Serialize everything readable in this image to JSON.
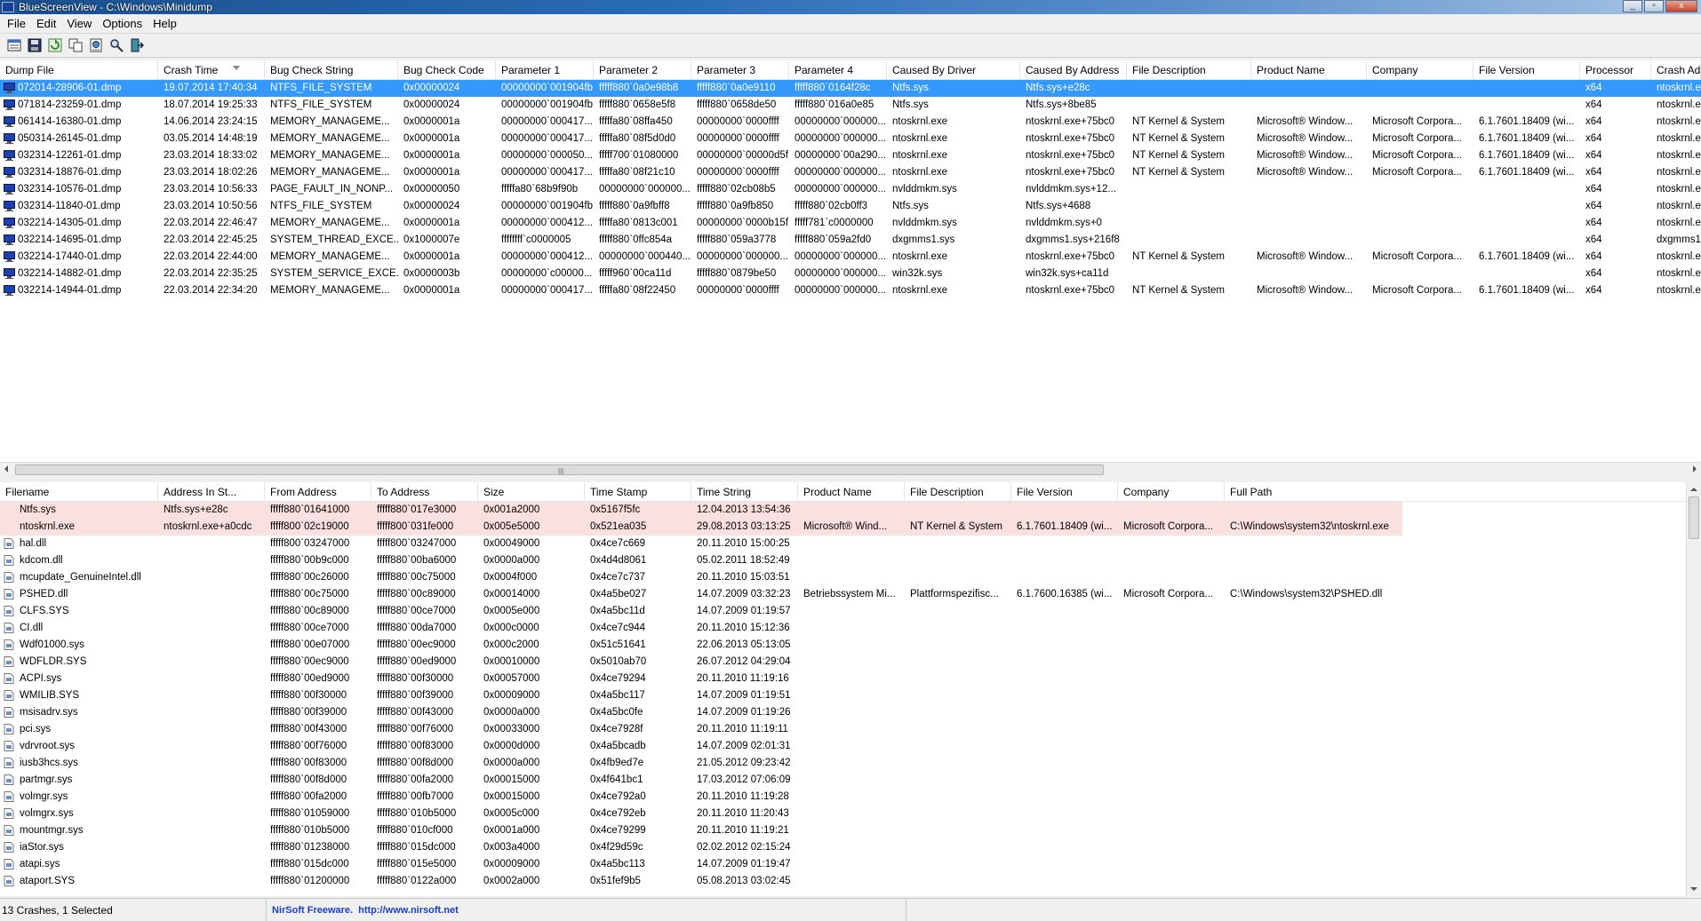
{
  "window": {
    "title": "BlueScreenView  -  C:\\Windows\\Minidump"
  },
  "menu": [
    "File",
    "Edit",
    "View",
    "Options",
    "Help"
  ],
  "toolbar": {
    "buttons": [
      "properties-icon",
      "save-icon",
      "refresh-icon",
      "copy-icon",
      "html-report-icon",
      "find-icon",
      "exit-icon"
    ]
  },
  "top_table": {
    "columns": [
      "Dump File",
      "Crash Time",
      "Bug Check String",
      "Bug Check Code",
      "Parameter 1",
      "Parameter 2",
      "Parameter 3",
      "Parameter 4",
      "Caused By Driver",
      "Caused By Address",
      "File Description",
      "Product Name",
      "Company",
      "File Version",
      "Processor",
      "Crash Ad"
    ],
    "sorted_column": "Crash Time",
    "rows": [
      [
        "072014-28906-01.dmp",
        "19.07.2014 17:40:34",
        "NTFS_FILE_SYSTEM",
        "0x00000024",
        "00000000`001904fb",
        "fffff880`0a0e98b8",
        "fffff880`0a0e9110",
        "fffff880`0164f28c",
        "Ntfs.sys",
        "Ntfs.sys+e28c",
        "",
        "",
        "",
        "",
        "x64",
        "ntoskrnl.e"
      ],
      [
        "071814-23259-01.dmp",
        "18.07.2014 19:25:33",
        "NTFS_FILE_SYSTEM",
        "0x00000024",
        "00000000`001904fb",
        "fffff880`0658e5f8",
        "fffff880`0658de50",
        "fffff880`016a0e85",
        "Ntfs.sys",
        "Ntfs.sys+8be85",
        "",
        "",
        "",
        "",
        "x64",
        "ntoskrnl.e"
      ],
      [
        "061414-16380-01.dmp",
        "14.06.2014 23:24:15",
        "MEMORY_MANAGEME...",
        "0x0000001a",
        "00000000`000417...",
        "fffffa80`08ffa450",
        "00000000`0000ffff",
        "00000000`000000...",
        "ntoskrnl.exe",
        "ntoskrnl.exe+75bc0",
        "NT Kernel & System",
        "Microsoft® Window...",
        "Microsoft Corpora...",
        "6.1.7601.18409 (wi...",
        "x64",
        "ntoskrnl.e"
      ],
      [
        "050314-26145-01.dmp",
        "03.05.2014 14:48:19",
        "MEMORY_MANAGEME...",
        "0x0000001a",
        "00000000`000417...",
        "fffffa80`08f5d0d0",
        "00000000`0000ffff",
        "00000000`000000...",
        "ntoskrnl.exe",
        "ntoskrnl.exe+75bc0",
        "NT Kernel & System",
        "Microsoft® Window...",
        "Microsoft Corpora...",
        "6.1.7601.18409 (wi...",
        "x64",
        "ntoskrnl.e"
      ],
      [
        "032314-12261-01.dmp",
        "23.03.2014 18:33:02",
        "MEMORY_MANAGEME...",
        "0x0000001a",
        "00000000`000050...",
        "fffff700`01080000",
        "00000000`00000d5f",
        "00000000`00a290...",
        "ntoskrnl.exe",
        "ntoskrnl.exe+75bc0",
        "NT Kernel & System",
        "Microsoft® Window...",
        "Microsoft Corpora...",
        "6.1.7601.18409 (wi...",
        "x64",
        "ntoskrnl.e"
      ],
      [
        "032314-18876-01.dmp",
        "23.03.2014 18:02:26",
        "MEMORY_MANAGEME...",
        "0x0000001a",
        "00000000`000417...",
        "fffffa80`08f21c10",
        "00000000`0000ffff",
        "00000000`000000...",
        "ntoskrnl.exe",
        "ntoskrnl.exe+75bc0",
        "NT Kernel & System",
        "Microsoft® Window...",
        "Microsoft Corpora...",
        "6.1.7601.18409 (wi...",
        "x64",
        "ntoskrnl.e"
      ],
      [
        "032314-10576-01.dmp",
        "23.03.2014 10:56:33",
        "PAGE_FAULT_IN_NONP...",
        "0x00000050",
        "fffffa80`68b9f90b",
        "00000000`000000...",
        "fffff880`02cb08b5",
        "00000000`000000...",
        "nvlddmkm.sys",
        "nvlddmkm.sys+12...",
        "",
        "",
        "",
        "",
        "x64",
        "ntoskrnl.e"
      ],
      [
        "032314-11840-01.dmp",
        "23.03.2014 10:50:56",
        "NTFS_FILE_SYSTEM",
        "0x00000024",
        "00000000`001904fb",
        "fffff880`0a9fbff8",
        "fffff880`0a9fb850",
        "fffff880`02cb0ff3",
        "Ntfs.sys",
        "Ntfs.sys+4688",
        "",
        "",
        "",
        "",
        "x64",
        "ntoskrnl.e"
      ],
      [
        "032214-14305-01.dmp",
        "22.03.2014 22:46:47",
        "MEMORY_MANAGEME...",
        "0x0000001a",
        "00000000`000412...",
        "fffffa80`0813c001",
        "00000000`0000b15f",
        "fffff781`c0000000",
        "nvlddmkm.sys",
        "nvlddmkm.sys+0",
        "",
        "",
        "",
        "",
        "x64",
        "ntoskrnl.e"
      ],
      [
        "032214-14695-01.dmp",
        "22.03.2014 22:45:25",
        "SYSTEM_THREAD_EXCE...",
        "0x1000007e",
        "ffffffff`c0000005",
        "fffff880`0ffc854a",
        "fffff880`059a3778",
        "fffff880`059a2fd0",
        "dxgmms1.sys",
        "dxgmms1.sys+216f8",
        "",
        "",
        "",
        "",
        "x64",
        "dxgmms1"
      ],
      [
        "032214-17440-01.dmp",
        "22.03.2014 22:44:00",
        "MEMORY_MANAGEME...",
        "0x0000001a",
        "00000000`000412...",
        "00000000`000440...",
        "00000000`000000...",
        "00000000`000000...",
        "ntoskrnl.exe",
        "ntoskrnl.exe+75bc0",
        "NT Kernel & System",
        "Microsoft® Window...",
        "Microsoft Corpora...",
        "6.1.7601.18409 (wi...",
        "x64",
        "ntoskrnl.e"
      ],
      [
        "032214-14882-01.dmp",
        "22.03.2014 22:35:25",
        "SYSTEM_SERVICE_EXCE...",
        "0x0000003b",
        "00000000`c00000...",
        "fffff960`00ca11d",
        "fffff880`0879be50",
        "00000000`000000...",
        "win32k.sys",
        "win32k.sys+ca11d",
        "",
        "",
        "",
        "",
        "x64",
        "ntoskrnl.e"
      ],
      [
        "032214-14944-01.dmp",
        "22.03.2014 22:34:20",
        "MEMORY_MANAGEME...",
        "0x0000001a",
        "00000000`000417...",
        "fffffa80`08f22450",
        "00000000`0000ffff",
        "00000000`000000...",
        "ntoskrnl.exe",
        "ntoskrnl.exe+75bc0",
        "NT Kernel & System",
        "Microsoft® Window...",
        "Microsoft Corpora...",
        "6.1.7601.18409 (wi...",
        "x64",
        "ntoskrnl.e"
      ]
    ]
  },
  "bottom_table": {
    "columns": [
      "Filename",
      "Address In St...",
      "From Address",
      "To Address",
      "Size",
      "Time Stamp",
      "Time String",
      "Product Name",
      "File Description",
      "File Version",
      "Company",
      "Full Path"
    ],
    "rows": [
      [
        "Ntfs.sys",
        "Ntfs.sys+e28c",
        "fffff880`01641000",
        "fffff880`017e3000",
        "0x001a2000",
        "0x5167f5fc",
        "12.04.2013 13:54:36",
        "",
        "",
        "",
        "",
        ""
      ],
      [
        "ntoskrnl.exe",
        "ntoskrnl.exe+a0cdc",
        "fffff800`02c19000",
        "fffff800`031fe000",
        "0x005e5000",
        "0x521ea035",
        "29.08.2013 03:13:25",
        "Microsoft® Wind...",
        "NT Kernel & System",
        "6.1.7601.18409 (wi...",
        "Microsoft Corpora...",
        "C:\\Windows\\system32\\ntoskrnl.exe"
      ],
      [
        "hal.dll",
        "",
        "fffff800`03247000",
        "fffff800`03247000",
        "0x00049000",
        "0x4ce7c669",
        "20.11.2010 15:00:25",
        "",
        "",
        "",
        "",
        ""
      ],
      [
        "kdcom.dll",
        "",
        "fffff880`00b9c000",
        "fffff880`00ba6000",
        "0x0000a000",
        "0x4d4d8061",
        "05.02.2011 18:52:49",
        "",
        "",
        "",
        "",
        ""
      ],
      [
        "mcupdate_GenuineIntel.dll",
        "",
        "fffff880`00c26000",
        "fffff880`00c75000",
        "0x0004f000",
        "0x4ce7c737",
        "20.11.2010 15:03:51",
        "",
        "",
        "",
        "",
        ""
      ],
      [
        "PSHED.dll",
        "",
        "fffff880`00c75000",
        "fffff880`00c89000",
        "0x00014000",
        "0x4a5be027",
        "14.07.2009 03:32:23",
        "Betriebssystem Mi...",
        "Plattformspezifisc...",
        "6.1.7600.16385 (wi...",
        "Microsoft Corpora...",
        "C:\\Windows\\system32\\PSHED.dll"
      ],
      [
        "CLFS.SYS",
        "",
        "fffff880`00c89000",
        "fffff880`00ce7000",
        "0x0005e000",
        "0x4a5bc11d",
        "14.07.2009 01:19:57",
        "",
        "",
        "",
        "",
        ""
      ],
      [
        "CI.dll",
        "",
        "fffff880`00ce7000",
        "fffff880`00da7000",
        "0x000c0000",
        "0x4ce7c944",
        "20.11.2010 15:12:36",
        "",
        "",
        "",
        "",
        ""
      ],
      [
        "Wdf01000.sys",
        "",
        "fffff880`00e07000",
        "fffff880`00ec9000",
        "0x000c2000",
        "0x51c51641",
        "22.06.2013 05:13:05",
        "",
        "",
        "",
        "",
        ""
      ],
      [
        "WDFLDR.SYS",
        "",
        "fffff880`00ec9000",
        "fffff880`00ed9000",
        "0x00010000",
        "0x5010ab70",
        "26.07.2012 04:29:04",
        "",
        "",
        "",
        "",
        ""
      ],
      [
        "ACPI.sys",
        "",
        "fffff880`00ed9000",
        "fffff880`00f30000",
        "0x00057000",
        "0x4ce79294",
        "20.11.2010 11:19:16",
        "",
        "",
        "",
        "",
        ""
      ],
      [
        "WMILIB.SYS",
        "",
        "fffff880`00f30000",
        "fffff880`00f39000",
        "0x00009000",
        "0x4a5bc117",
        "14.07.2009 01:19:51",
        "",
        "",
        "",
        "",
        ""
      ],
      [
        "msisadrv.sys",
        "",
        "fffff880`00f39000",
        "fffff880`00f43000",
        "0x0000a000",
        "0x4a5bc0fe",
        "14.07.2009 01:19:26",
        "",
        "",
        "",
        "",
        ""
      ],
      [
        "pci.sys",
        "",
        "fffff880`00f43000",
        "fffff880`00f76000",
        "0x00033000",
        "0x4ce7928f",
        "20.11.2010 11:19:11",
        "",
        "",
        "",
        "",
        ""
      ],
      [
        "vdrvroot.sys",
        "",
        "fffff880`00f76000",
        "fffff880`00f83000",
        "0x0000d000",
        "0x4a5bcadb",
        "14.07.2009 02:01:31",
        "",
        "",
        "",
        "",
        ""
      ],
      [
        "iusb3hcs.sys",
        "",
        "fffff880`00f83000",
        "fffff880`00f8d000",
        "0x0000a000",
        "0x4fb9ed7e",
        "21.05.2012 09:23:42",
        "",
        "",
        "",
        "",
        ""
      ],
      [
        "partmgr.sys",
        "",
        "fffff880`00f8d000",
        "fffff880`00fa2000",
        "0x00015000",
        "0x4f641bc1",
        "17.03.2012 07:06:09",
        "",
        "",
        "",
        "",
        ""
      ],
      [
        "volmgr.sys",
        "",
        "fffff880`00fa2000",
        "fffff880`00fb7000",
        "0x00015000",
        "0x4ce792a0",
        "20.11.2010 11:19:28",
        "",
        "",
        "",
        "",
        ""
      ],
      [
        "volmgrx.sys",
        "",
        "fffff880`01059000",
        "fffff880`010b5000",
        "0x0005c000",
        "0x4ce792eb",
        "20.11.2010 11:20:43",
        "",
        "",
        "",
        "",
        ""
      ],
      [
        "mountmgr.sys",
        "",
        "fffff880`010b5000",
        "fffff880`010cf000",
        "0x0001a000",
        "0x4ce79299",
        "20.11.2010 11:19:21",
        "",
        "",
        "",
        "",
        ""
      ],
      [
        "iaStor.sys",
        "",
        "fffff880`01238000",
        "fffff880`015dc000",
        "0x003a4000",
        "0x4f29d59c",
        "02.02.2012 02:15:24",
        "",
        "",
        "",
        "",
        ""
      ],
      [
        "atapi.sys",
        "",
        "fffff880`015dc000",
        "fffff880`015e5000",
        "0x00009000",
        "0x4a5bc113",
        "14.07.2009 01:19:47",
        "",
        "",
        "",
        "",
        ""
      ],
      [
        "ataport.SYS",
        "",
        "fffff880`01200000",
        "fffff880`0122a000",
        "0x0002a000",
        "0x51fef9b5",
        "05.08.2013 03:02:45",
        "",
        "",
        "",
        "",
        ""
      ]
    ]
  },
  "status": {
    "summary": "13 Crashes, 1 Selected",
    "freeware": "NirSoft Freeware.",
    "url": "http://www.nirsoft.net"
  },
  "colors": {
    "selection": "#3399ff",
    "highlight": "#fbe0e0",
    "link": "#1a3fc4"
  }
}
